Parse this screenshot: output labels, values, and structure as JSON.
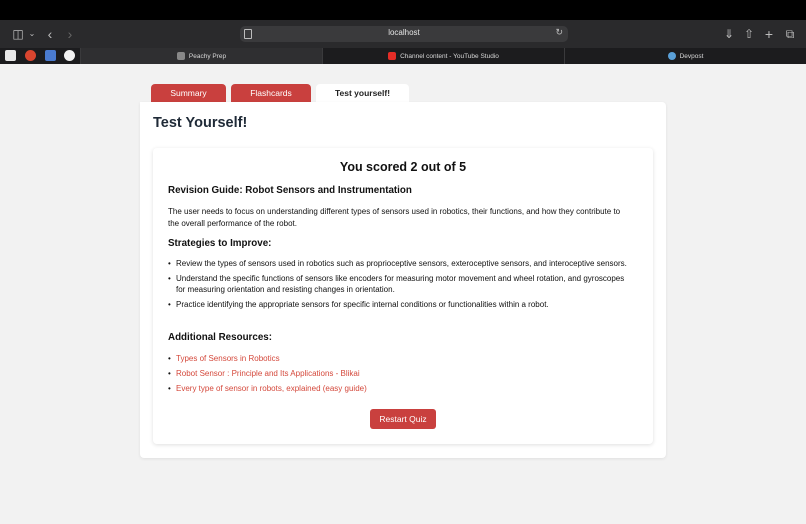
{
  "browser": {
    "url": "localhost",
    "tabs": [
      {
        "label": "Peachy Prep",
        "favicon_letter": "L"
      },
      {
        "label": "Channel content - YouTube Studio"
      },
      {
        "label": "Devpost"
      }
    ]
  },
  "page": {
    "tabs": [
      "Summary",
      "Flashcards",
      "Test yourself!"
    ],
    "title": "Test Yourself!",
    "score": "You scored 2 out of 5",
    "guide_heading": "Revision Guide: Robot Sensors and Instrumentation",
    "guide_text": "The user needs to focus on understanding different types of sensors used in robotics, their functions, and how they contribute to the overall performance of the robot.",
    "strategies_heading": "Strategies to Improve:",
    "strategies": [
      "Review the types of sensors used in robotics such as proprioceptive sensors, exteroceptive sensors, and interoceptive sensors.",
      "Understand the specific functions of sensors like encoders for measuring motor movement and wheel rotation, and gyroscopes for measuring orientation and resisting changes in orientation.",
      "Practice identifying the appropriate sensors for specific internal conditions or functionalities within a robot."
    ],
    "resources_heading": "Additional Resources:",
    "resources": [
      "Types of Sensors in Robotics",
      "Robot Sensor : Principle and Its Applications - Blikai",
      "Every type of sensor in robots, explained (easy guide)"
    ],
    "restart_label": "Restart Quiz"
  },
  "colors": {
    "accent": "#c9403e",
    "link": "#d4483b"
  }
}
